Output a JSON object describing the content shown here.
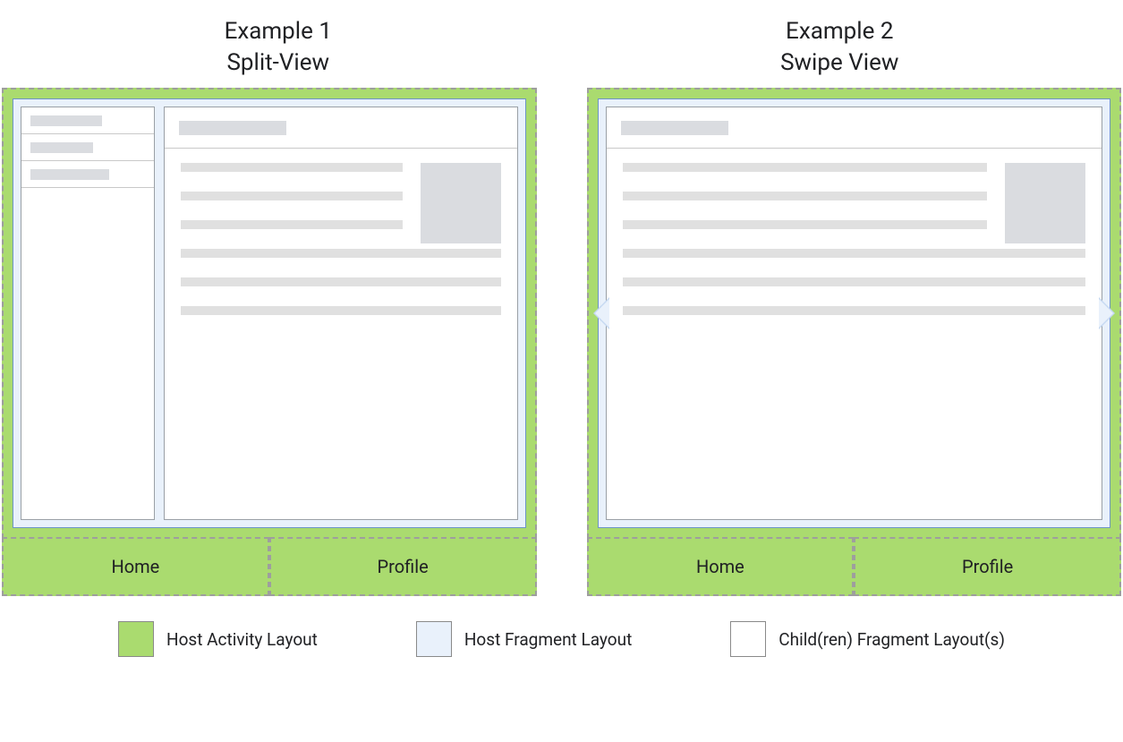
{
  "examples": {
    "left": {
      "title_top": "Example 1",
      "title_bottom": "Split-View"
    },
    "right": {
      "title_top": "Example 2",
      "title_bottom": "Swipe View"
    }
  },
  "tabs": {
    "home": "Home",
    "profile": "Profile"
  },
  "legend": {
    "host_activity": "Host Activity Layout",
    "host_fragment": "Host Fragment Layout",
    "child_fragment": "Child(ren) Fragment Layout(s)"
  }
}
